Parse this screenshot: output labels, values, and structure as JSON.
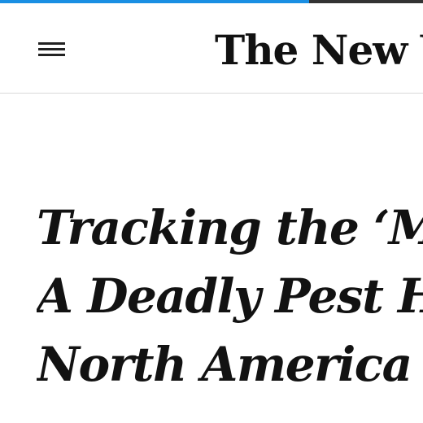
{
  "progress": {
    "value": 0.73,
    "fill_color": "#1a8fe3",
    "track_color": "#333333"
  },
  "header": {
    "menu_icon": "hamburger-menu-icon",
    "masthead": "The New Yo"
  },
  "article": {
    "headline_lines": [
      "Tracking the ‘Mu",
      "A Deadly Pest Ha",
      "North America"
    ]
  }
}
